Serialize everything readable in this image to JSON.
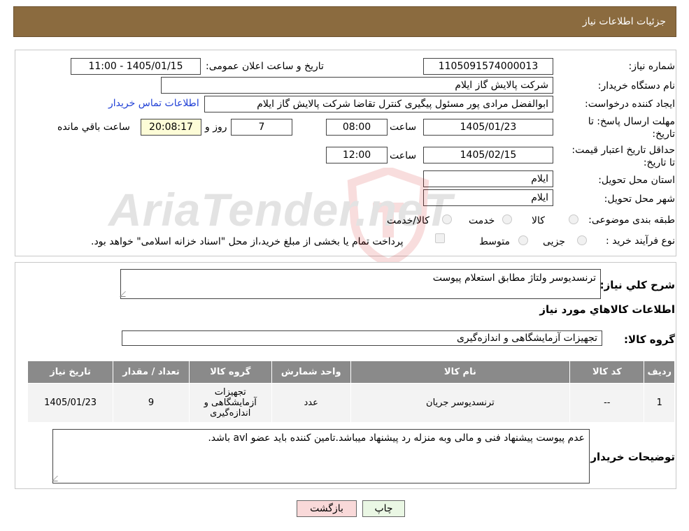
{
  "header": {
    "title": "جزئیات اطلاعات نیاز"
  },
  "fields": {
    "need_number": {
      "label": "شماره نیاز:",
      "value": "1105091574000013"
    },
    "announce_datetime": {
      "label": "تاریخ و ساعت اعلان عمومی:",
      "value": "1405/01/15 - 11:00"
    },
    "buyer_org": {
      "label": "نام دستگاه خریدار:",
      "value": "شرکت پالایش گاز ایلام"
    },
    "requester": {
      "label": "ایجاد کننده درخواست:",
      "value": "ابوالفضل مرادی پور مسئول پیگیری کنترل تقاضا شرکت پالایش گاز ایلام"
    },
    "buyer_contact_link": "اطلاعات تماس خریدار",
    "reply_deadline": {
      "label": "مهلت ارسال پاسخ: تا تاریخ:",
      "date": "1405/01/23",
      "time_label": "ساعت",
      "time": "08:00",
      "days": "7",
      "days_label": "روز و",
      "remaining": "20:08:17",
      "remaining_label": "ساعت باقي مانده"
    },
    "price_validity": {
      "label": "حداقل تاریخ اعتبار قیمت: تا تاریخ:",
      "date": "1405/02/15",
      "time_label": "ساعت",
      "time": "12:00"
    },
    "delivery_province": {
      "label": "استان محل تحویل:",
      "value": "ایلام"
    },
    "delivery_city": {
      "label": "شهر محل تحویل:",
      "value": "ایلام"
    },
    "category": {
      "label": "طبقه بندی موضوعی:",
      "options": [
        "کالا",
        "خدمت",
        "کالا/خدمت"
      ]
    },
    "purchase_type": {
      "label": "نوع فرآیند خرید :",
      "options": [
        "جزیی",
        "متوسط"
      ],
      "payment_note": "پرداخت تمام یا بخشی از مبلغ خرید،از محل \"اسناد خزانه اسلامی\" خواهد بود."
    }
  },
  "description": {
    "label": "شرح کلي نیاز:",
    "value": "ترنسدیوسر ولتاژ مطابق استعلام پیوست"
  },
  "goods_section_title": "اطلاعات کالاهاي مورد نیاز",
  "goods_group": {
    "label": "گروه کالا:",
    "value": "تجهیزات آزمایشگاهی و اندازه‌گیری"
  },
  "table": {
    "headers": [
      "ردیف",
      "کد کالا",
      "نام کالا",
      "واحد شمارش",
      "گروه کالا",
      "تعداد / مقدار",
      "تاریخ نیاز"
    ],
    "rows": [
      [
        "1",
        "--",
        "ترنسدیوسر جریان",
        "عدد",
        "تجهیزات آزمایشگاهی و اندازه‌گیری",
        "9",
        "1405/01/23"
      ]
    ]
  },
  "buyer_notes": {
    "label": "توضیحات خریدار:",
    "value": "عدم پیوست پیشنهاد فنی و مالی وبه منزله رد پیشنهاد میباشد.تامین کننده باید عضو avl باشد."
  },
  "buttons": {
    "print": "چاپ",
    "back": "بازگشت"
  },
  "watermark": {
    "text": "AriaTender.neT"
  },
  "colors": {
    "header_bg": "#8b6b3f",
    "table_header_bg": "#8a8a8a",
    "link": "#1f3fd6",
    "back_btn": "#f9d9d9",
    "print_btn": "#eaf7e4"
  }
}
